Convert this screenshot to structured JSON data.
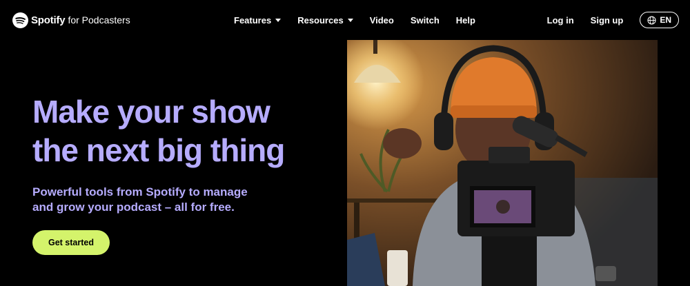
{
  "nav": {
    "brand": "Spotify",
    "brand_sub": "for Podcasters",
    "links": [
      {
        "label": "Features",
        "has_dropdown": true
      },
      {
        "label": "Resources",
        "has_dropdown": true
      },
      {
        "label": "Video",
        "has_dropdown": false
      },
      {
        "label": "Switch",
        "has_dropdown": false
      },
      {
        "label": "Help",
        "has_dropdown": false
      }
    ],
    "login": "Log in",
    "signup": "Sign up",
    "language": "EN"
  },
  "hero": {
    "title_line1": "Make your show",
    "title_line2": "the next big thing",
    "subtitle_line1": "Powerful tools from Spotify to manage",
    "subtitle_line2": "and grow your podcast – all for free.",
    "cta": "Get started",
    "image": "podcaster-with-camera-photo"
  },
  "colors": {
    "background": "#000000",
    "accent_text": "#b6acff",
    "cta_bg": "#d4f36b",
    "cta_text": "#000000",
    "nav_text": "#ffffff"
  },
  "icons": {
    "logo": "spotify-logo-icon",
    "dropdown": "caret-down-icon",
    "language": "globe-icon"
  }
}
